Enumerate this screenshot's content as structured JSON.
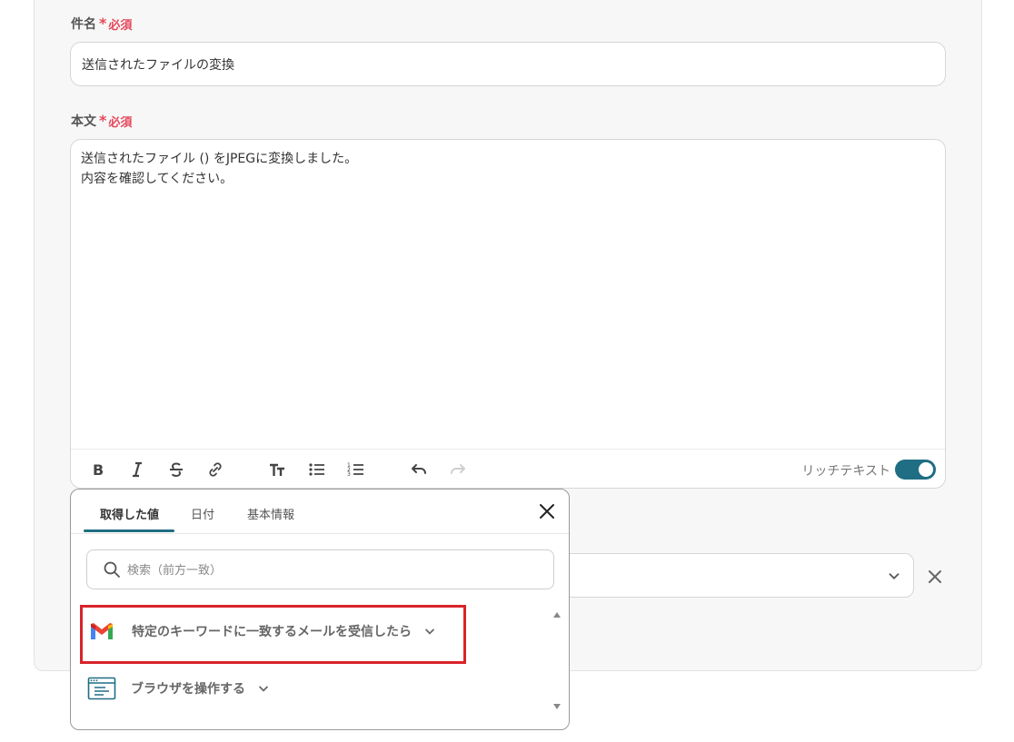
{
  "subject": {
    "label": "件名",
    "required": "必須",
    "value": "送信されたファイルの変換"
  },
  "body": {
    "label": "本文",
    "required": "必須",
    "text": "送信されたファイル () をJPEGに変換しました。\n内容を確認してください。",
    "rich_text_label": "リッチテキスト"
  },
  "popup": {
    "tabs": [
      {
        "label": "取得した値"
      },
      {
        "label": "日付"
      },
      {
        "label": "基本情報"
      }
    ],
    "search_placeholder": "検索（前方一致）",
    "items": [
      {
        "label": "特定のキーワードに一致するメールを受信したら",
        "icon": "gmail-icon"
      },
      {
        "label": "ブラウザを操作する",
        "icon": "browser-icon"
      }
    ]
  },
  "colors": {
    "accent": "#1f6e83",
    "required": "#e5475b",
    "highlight": "#d8232a"
  }
}
